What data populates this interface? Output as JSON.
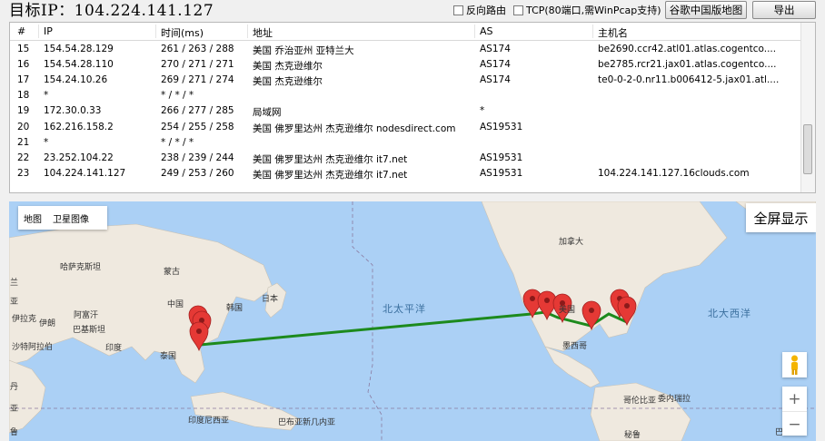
{
  "topbar": {
    "target_label": "目标IP：104.224.141.127",
    "reverse_route_label": "反向路由",
    "tcp_label": "TCP(80端口,需WinPcap支持)",
    "google_map_button": "谷歌中国版地图",
    "export_button": "导出"
  },
  "table": {
    "headers": [
      "#",
      "IP",
      "时间(ms)",
      "地址",
      "AS",
      "主机名"
    ],
    "rows": [
      [
        "15",
        "154.54.28.129",
        "261 / 263 / 288",
        "美国 乔治亚州 亚特兰大",
        "AS174",
        "be2690.ccr42.atl01.atlas.cogentco...."
      ],
      [
        "16",
        "154.54.28.110",
        "270 / 271 / 271",
        "美国 杰克逊维尔",
        "AS174",
        "be2785.rcr21.jax01.atlas.cogentco...."
      ],
      [
        "17",
        "154.24.10.26",
        "269 / 271 / 274",
        "美国 杰克逊维尔",
        "AS174",
        "te0-0-2-0.nr11.b006412-5.jax01.atl...."
      ],
      [
        "18",
        "*",
        "* / * / *",
        "",
        "",
        ""
      ],
      [
        "19",
        "172.30.0.33",
        "266 / 277 / 285",
        "局域网",
        "*",
        ""
      ],
      [
        "20",
        "162.216.158.2",
        "254 / 255 / 258",
        "美国 佛罗里达州 杰克逊维尔 nodesdirect.com",
        "AS19531",
        ""
      ],
      [
        "21",
        "*",
        "* / * / *",
        "",
        "",
        ""
      ],
      [
        "22",
        "23.252.104.22",
        "238 / 239 / 244",
        "美国 佛罗里达州 杰克逊维尔 it7.net",
        "AS19531",
        ""
      ],
      [
        "23",
        "104.224.141.127",
        "249 / 253 / 260",
        "美国 佛罗里达州 杰克逊维尔 it7.net",
        "AS19531",
        "104.224.141.127.16clouds.com"
      ]
    ]
  },
  "map": {
    "type_map": "地图",
    "type_satellite": "卫星图像",
    "fullscreen_label": "全屏显示",
    "zoom_in": "+",
    "zoom_out": "−",
    "ocean_labels": {
      "north_pacific": "北太平洋",
      "north_atlantic": "北大西洋"
    },
    "place_labels": {
      "mongolia": "蒙古",
      "kazakhstan": "哈萨克斯坦",
      "china": "中国",
      "afghanistan": "阿富汗",
      "pakistan": "巴基斯坦",
      "iran": "伊朗",
      "india": "印度",
      "thailand": "泰国",
      "japan": "日本",
      "korea": "韩国",
      "indonesia": "印度尼西亚",
      "papua": "巴布亚新几内亚",
      "canada": "加拿大",
      "usa": "美国",
      "mexico": "墨西哥",
      "venezuela": "委内瑞拉",
      "colombia": "哥伦比亚",
      "peru": "秘鲁",
      "iraq": "伊拉克",
      "saudi": "沙特阿拉伯",
      "arabia_edge": "亚",
      "sudan_edge": "丹",
      "sia_edge": "亚",
      "ly_edge": "兰",
      "lu_edge": "鲁",
      "br_edge": "巴"
    },
    "route_color": "#1d8a1d",
    "pin_color": "#e53935"
  }
}
